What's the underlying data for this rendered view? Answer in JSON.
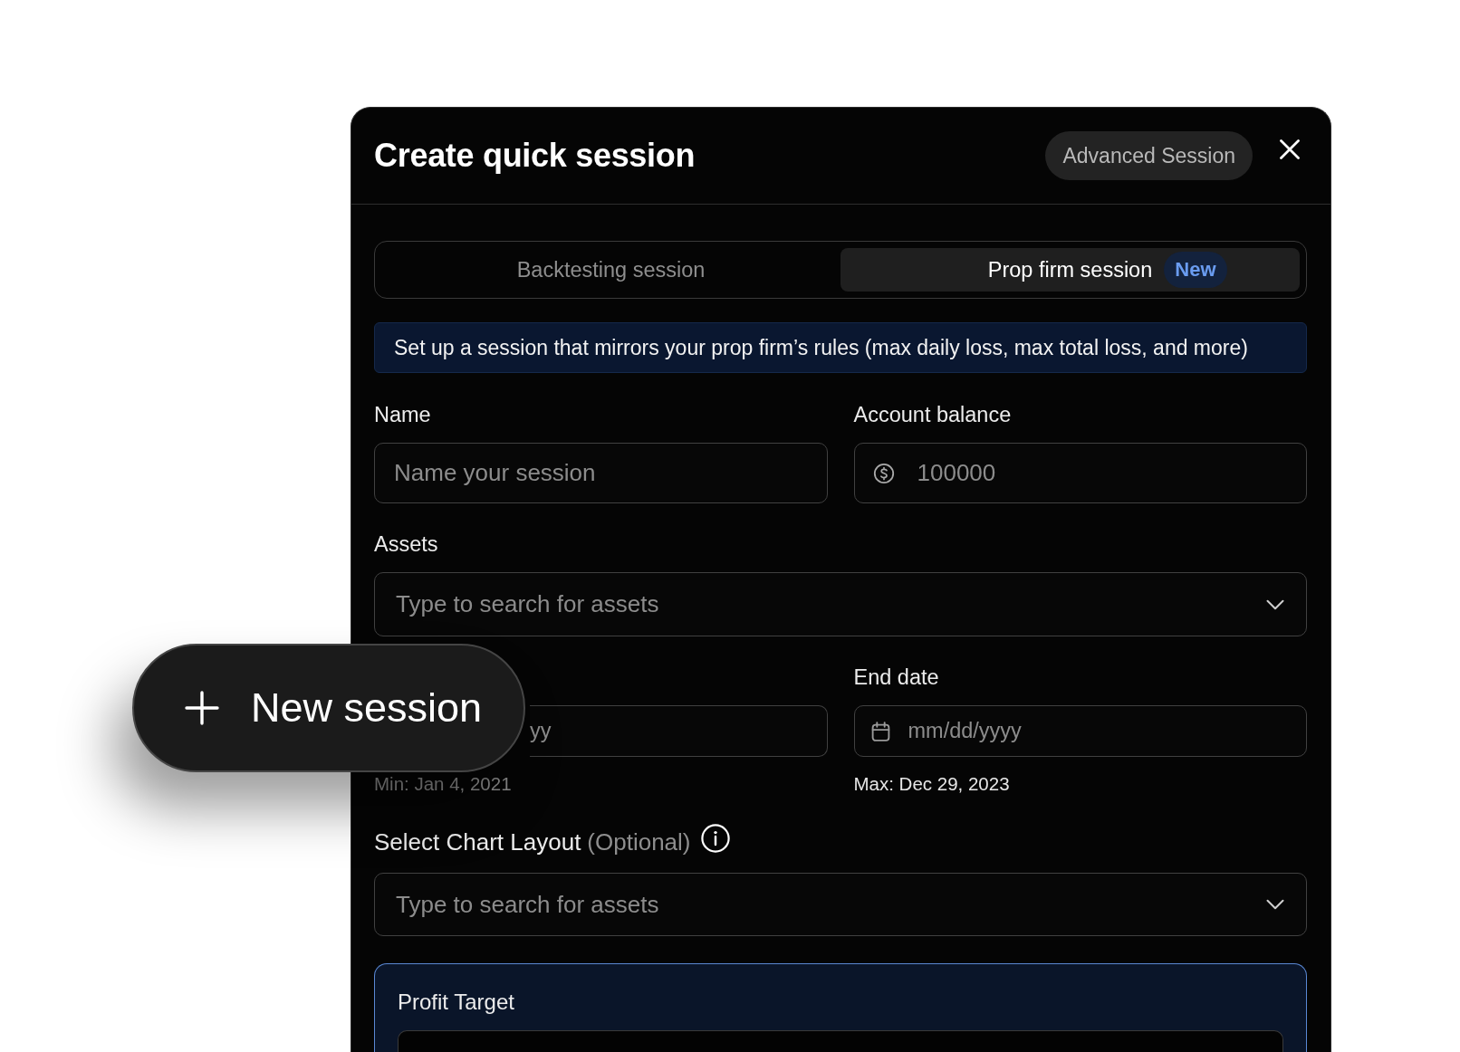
{
  "dialog": {
    "title": "Create quick session",
    "advanced_button": "Advanced Session"
  },
  "tabs": [
    {
      "label": "Backtesting session",
      "selected": false
    },
    {
      "label": "Prop firm session",
      "selected": true,
      "badge": "New"
    }
  ],
  "info_banner": "Set up a session that mirrors your prop firm’s rules (max daily loss, max total loss, and more)",
  "name_field": {
    "label": "Name",
    "placeholder": "Name your session"
  },
  "account_balance": {
    "label": "Account balance",
    "placeholder": "100000"
  },
  "assets": {
    "label": "Assets",
    "placeholder": "Type to search for assets"
  },
  "date_fields": [
    {
      "covered": true,
      "placeholder": "yy",
      "hint": "Min: Jan 4, 2021",
      "hint_greyed": true
    },
    {
      "covered": false,
      "label": "End date",
      "placeholder": "mm/dd/yyyy",
      "hint": "Max: Dec 29, 2023",
      "hint_greyed": false
    }
  ],
  "chart_layout": {
    "label": "Select Chart Layout",
    "optional": "(Optional)",
    "placeholder": "Type to search for assets"
  },
  "profit_target": {
    "label": "Profit Target"
  },
  "new_session_button": {
    "label": "New session"
  }
}
